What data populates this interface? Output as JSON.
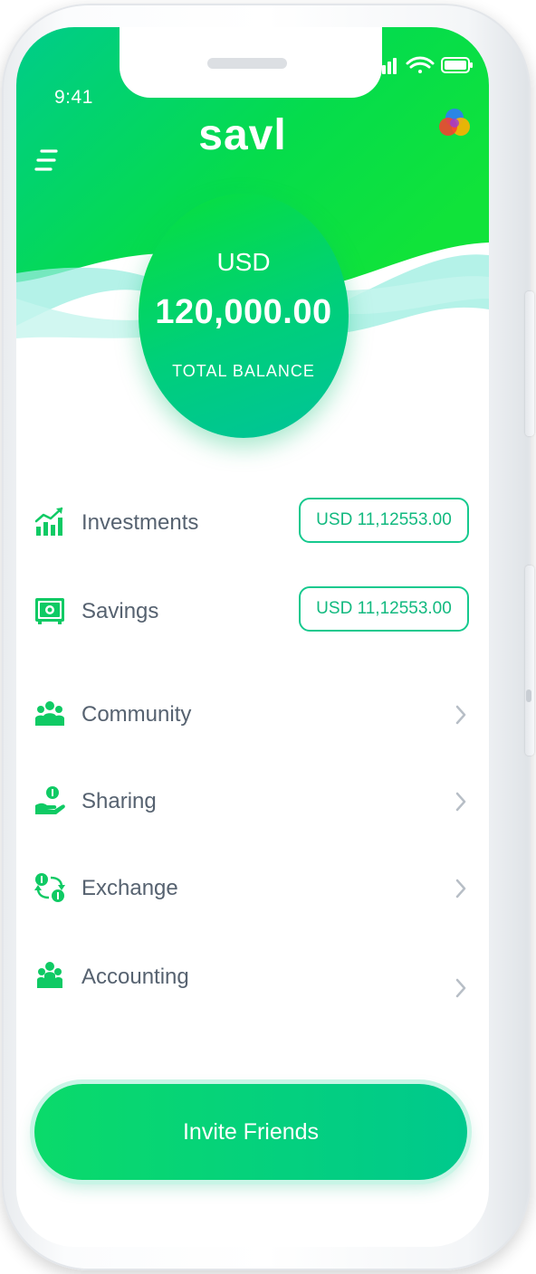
{
  "status_bar": {
    "time": "9:41"
  },
  "header": {
    "logo": "savl"
  },
  "balance": {
    "currency": "USD",
    "amount": "120,000.00",
    "label": "TOTAL BALANCE"
  },
  "accounts": [
    {
      "label": "Investments",
      "value": "USD 11,12553.00",
      "icon": "investments-chart-icon"
    },
    {
      "label": "Savings",
      "value": "USD 11,12553.00",
      "icon": "safe-icon"
    }
  ],
  "menu": [
    {
      "label": "Community",
      "icon": "community-group-icon"
    },
    {
      "label": "Sharing",
      "icon": "hand-coin-icon"
    },
    {
      "label": "Exchange",
      "icon": "exchange-icon"
    },
    {
      "label": "Accounting",
      "icon": "accounting-people-icon"
    }
  ],
  "invite_button": {
    "label": "Invite Friends"
  },
  "colors": {
    "accent_green": "#05e040",
    "accent_teal": "#00c39a",
    "text_gray": "#566270",
    "pill_border": "#16c98e"
  }
}
